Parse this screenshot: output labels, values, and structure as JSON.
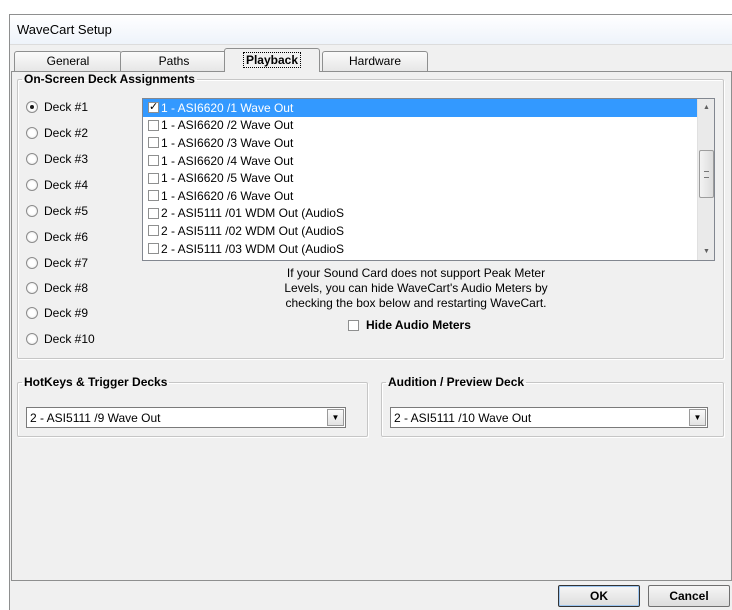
{
  "window": {
    "title": "WaveCart Setup"
  },
  "tabs": [
    {
      "label": "General"
    },
    {
      "label": "Paths"
    },
    {
      "label": "Playback",
      "active": true
    },
    {
      "label": "Hardware"
    }
  ],
  "deck_assignments": {
    "legend": "On-Screen Deck Assignments",
    "decks": [
      {
        "label": "Deck #1",
        "selected": true
      },
      {
        "label": "Deck #2"
      },
      {
        "label": "Deck #3"
      },
      {
        "label": "Deck #4"
      },
      {
        "label": "Deck #5"
      },
      {
        "label": "Deck #6"
      },
      {
        "label": "Deck #7"
      },
      {
        "label": "Deck #8"
      },
      {
        "label": "Deck #9"
      },
      {
        "label": "Deck #10"
      }
    ],
    "outputs": [
      {
        "label": "1 - ASI6620 /1 Wave Out",
        "checked": true,
        "selected": true
      },
      {
        "label": "1 - ASI6620 /2 Wave Out",
        "checked": false
      },
      {
        "label": "1 - ASI6620 /3 Wave Out",
        "checked": false
      },
      {
        "label": "1 - ASI6620 /4 Wave Out",
        "checked": false
      },
      {
        "label": "1 - ASI6620 /5 Wave Out",
        "checked": false
      },
      {
        "label": "1 - ASI6620 /6 Wave Out",
        "checked": false
      },
      {
        "label": "2 - ASI5111 /01 WDM Out (AudioS",
        "checked": false
      },
      {
        "label": "2 - ASI5111 /02 WDM Out (AudioS",
        "checked": false
      },
      {
        "label": "2 - ASI5111 /03 WDM Out (AudioS",
        "checked": false
      }
    ],
    "info_lines": [
      "If your Sound Card does not support Peak Meter",
      "Levels, you can hide WaveCart's Audio Meters by",
      "checking the box below and restarting WaveCart."
    ],
    "hide_meters_label": "Hide Audio Meters",
    "hide_meters_checked": false
  },
  "hotkeys": {
    "legend": "HotKeys & Trigger Decks",
    "value": "2 - ASI5111 /9 Wave Out"
  },
  "audition": {
    "legend": "Audition / Preview Deck",
    "value": "2 - ASI5111 /10 Wave Out"
  },
  "buttons": {
    "ok": "OK",
    "cancel": "Cancel"
  },
  "icons": {
    "radio": "radio-button-icon",
    "checkbox": "checkbox-icon",
    "dropdown": "chevron-down-icon",
    "scroll_up": "scroll-up-arrow-icon",
    "scroll_down": "scroll-down-arrow-icon"
  }
}
